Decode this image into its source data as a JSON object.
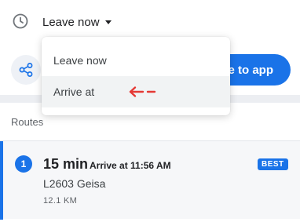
{
  "departure": {
    "selected_label": "Leave now",
    "icon": "clock-icon",
    "options": [
      {
        "label": "Leave now"
      },
      {
        "label": "Arrive at"
      }
    ]
  },
  "actions": {
    "share_icon": "share-icon",
    "app_button_label": "e to app"
  },
  "routes": {
    "heading": "Routes",
    "items": [
      {
        "number": "1",
        "duration": "15 min",
        "arrive": "Arrive at 11:56 AM",
        "badge": "BEST",
        "road": "L2603 Geisa",
        "distance": "12.1 KM"
      }
    ]
  },
  "colors": {
    "accent": "#1a73e8",
    "annotation_arrow": "#e53935"
  }
}
